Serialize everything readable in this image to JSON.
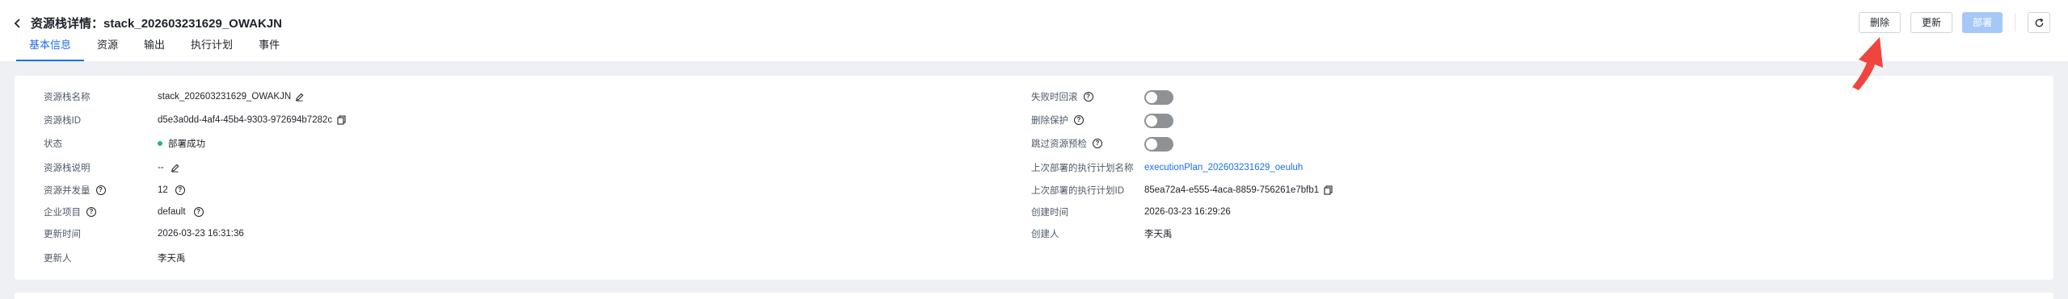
{
  "header": {
    "title": "资源栈详情：stack_202603231629_OWAKJN",
    "tabs": [
      {
        "label": "基本信息",
        "active": true
      },
      {
        "label": "资源",
        "active": false
      },
      {
        "label": "输出",
        "active": false
      },
      {
        "label": "执行计划",
        "active": false
      },
      {
        "label": "事件",
        "active": false
      }
    ],
    "buttons": {
      "delete": "删除",
      "update": "更新",
      "deploy": "部署"
    }
  },
  "info_left": {
    "stack_name": {
      "label": "资源栈名称",
      "value": "stack_202603231629_OWAKJN"
    },
    "stack_id": {
      "label": "资源栈ID",
      "value": "d5e3a0dd-4af4-45b4-9303-972694b7282c"
    },
    "status": {
      "label": "状态",
      "value": "部署成功"
    },
    "description": {
      "label": "资源栈说明",
      "value": "--"
    },
    "concurrency": {
      "label": "资源并发量",
      "value": "12"
    },
    "enterprise_project": {
      "label": "企业项目",
      "value": "default"
    },
    "update_time": {
      "label": "更新时间",
      "value": "2026-03-23 16:31:36"
    },
    "updater": {
      "label": "更新人",
      "value": "李天禹"
    }
  },
  "info_right": {
    "rollback_on_failure": {
      "label": "失败时回滚",
      "enabled": false
    },
    "delete_protection": {
      "label": "删除保护",
      "enabled": false
    },
    "skip_precheck": {
      "label": "跳过资源预检",
      "enabled": false
    },
    "last_plan_name": {
      "label": "上次部署的执行计划名称",
      "value": "executionPlan_202603231629_oeuluh"
    },
    "last_plan_id": {
      "label": "上次部署的执行计划ID",
      "value": "85ea72a4-e555-4aca-8859-756261e7bfb1"
    },
    "create_time": {
      "label": "创建时间",
      "value": "2026-03-23 16:29:26"
    },
    "creator": {
      "label": "创建人",
      "value": "李天禹"
    }
  },
  "colors": {
    "accent": "#1d6fe8",
    "status_success": "#25b57f",
    "deploy_disabled": "#a6c8f7",
    "annotation_arrow": "#f0453e"
  },
  "icons": [
    "chevron-left-icon",
    "refresh-icon",
    "edit-icon",
    "copy-icon",
    "question-icon",
    "annotation-arrow-icon"
  ]
}
